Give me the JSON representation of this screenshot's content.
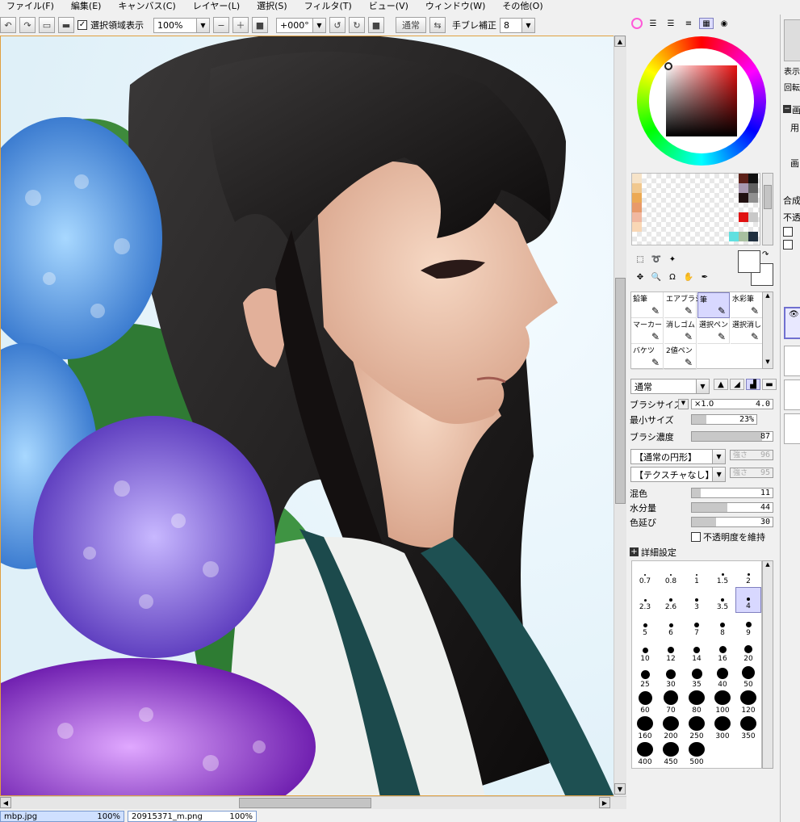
{
  "menu": [
    "ファイル(F)",
    "編集(E)",
    "キャンバス(C)",
    "レイヤー(L)",
    "選択(S)",
    "フィルタ(T)",
    "ビュー(V)",
    "ウィンドウ(W)",
    "その他(O)"
  ],
  "toolbar": {
    "selection_display_label": "選択領域表示",
    "selection_display_checked": true,
    "zoom_value": "100%",
    "rotation_value": "+000°",
    "blend_mode": "通常",
    "stabilizer_label": "手ブレ補正",
    "stabilizer_value": "8"
  },
  "brush_tools": [
    {
      "label": "鉛筆"
    },
    {
      "label": "エアブラシ"
    },
    {
      "label": "筆",
      "selected": true
    },
    {
      "label": "水彩筆"
    },
    {
      "label": "マーカー"
    },
    {
      "label": "消しゴム"
    },
    {
      "label": "選択ペン"
    },
    {
      "label": "選択消し"
    },
    {
      "label": "バケツ"
    },
    {
      "label": "2値ペン"
    }
  ],
  "brush_settings": {
    "mode": "通常",
    "size_label": "ブラシサイズ",
    "size_multiplier": "×1.0",
    "size_value": "4.0",
    "min_size_label": "最小サイズ",
    "min_size_value": "23%",
    "min_size_level": 0.23,
    "density_label": "ブラシ濃度",
    "density_value": "87",
    "density_level": 0.87,
    "shape": "【通常の円形】",
    "shape_strength_label": "強さ",
    "shape_strength": "96",
    "texture": "【テクスチャなし】",
    "texture_strength_label": "強さ",
    "texture_strength": "95",
    "blend_label": "混色",
    "blend_value": "11",
    "blend_level": 0.11,
    "water_label": "水分量",
    "water_value": "44",
    "water_level": 0.44,
    "stretch_label": "色延び",
    "stretch_value": "30",
    "stretch_level": 0.3,
    "keep_opacity_label": "不透明度を維持",
    "advanced_label": "詳細設定"
  },
  "brush_sizes": [
    "0.7",
    "0.8",
    "1",
    "1.5",
    "2",
    "2.3",
    "2.6",
    "3",
    "3.5",
    "4",
    "5",
    "6",
    "7",
    "8",
    "9",
    "10",
    "12",
    "14",
    "16",
    "20",
    "25",
    "30",
    "35",
    "40",
    "50",
    "60",
    "70",
    "80",
    "100",
    "120",
    "160",
    "200",
    "250",
    "300",
    "350",
    "400",
    "450",
    "500"
  ],
  "selected_brush_size": "4",
  "palette_colors": [
    "#f6e3c8",
    "#f1c88e",
    "#eca954",
    "#e89a6a",
    "#f1b8a0",
    "#f9d7b5",
    "#5c2018",
    "#101010",
    "#a898b0",
    "#606060",
    "#201010",
    "#909090",
    "#e01010",
    "#c8c8c8",
    "#60e0e0",
    "#a8c0a0",
    "#203040"
  ],
  "documents": [
    {
      "name": "mbp.jpg",
      "zoom": "100%",
      "active": true
    },
    {
      "name": "20915371_m.png",
      "zoom": "100%",
      "active": false
    }
  ],
  "right_edge_labels": [
    "表示",
    "回転",
    "画",
    "用",
    "画",
    "合成",
    "不透"
  ]
}
